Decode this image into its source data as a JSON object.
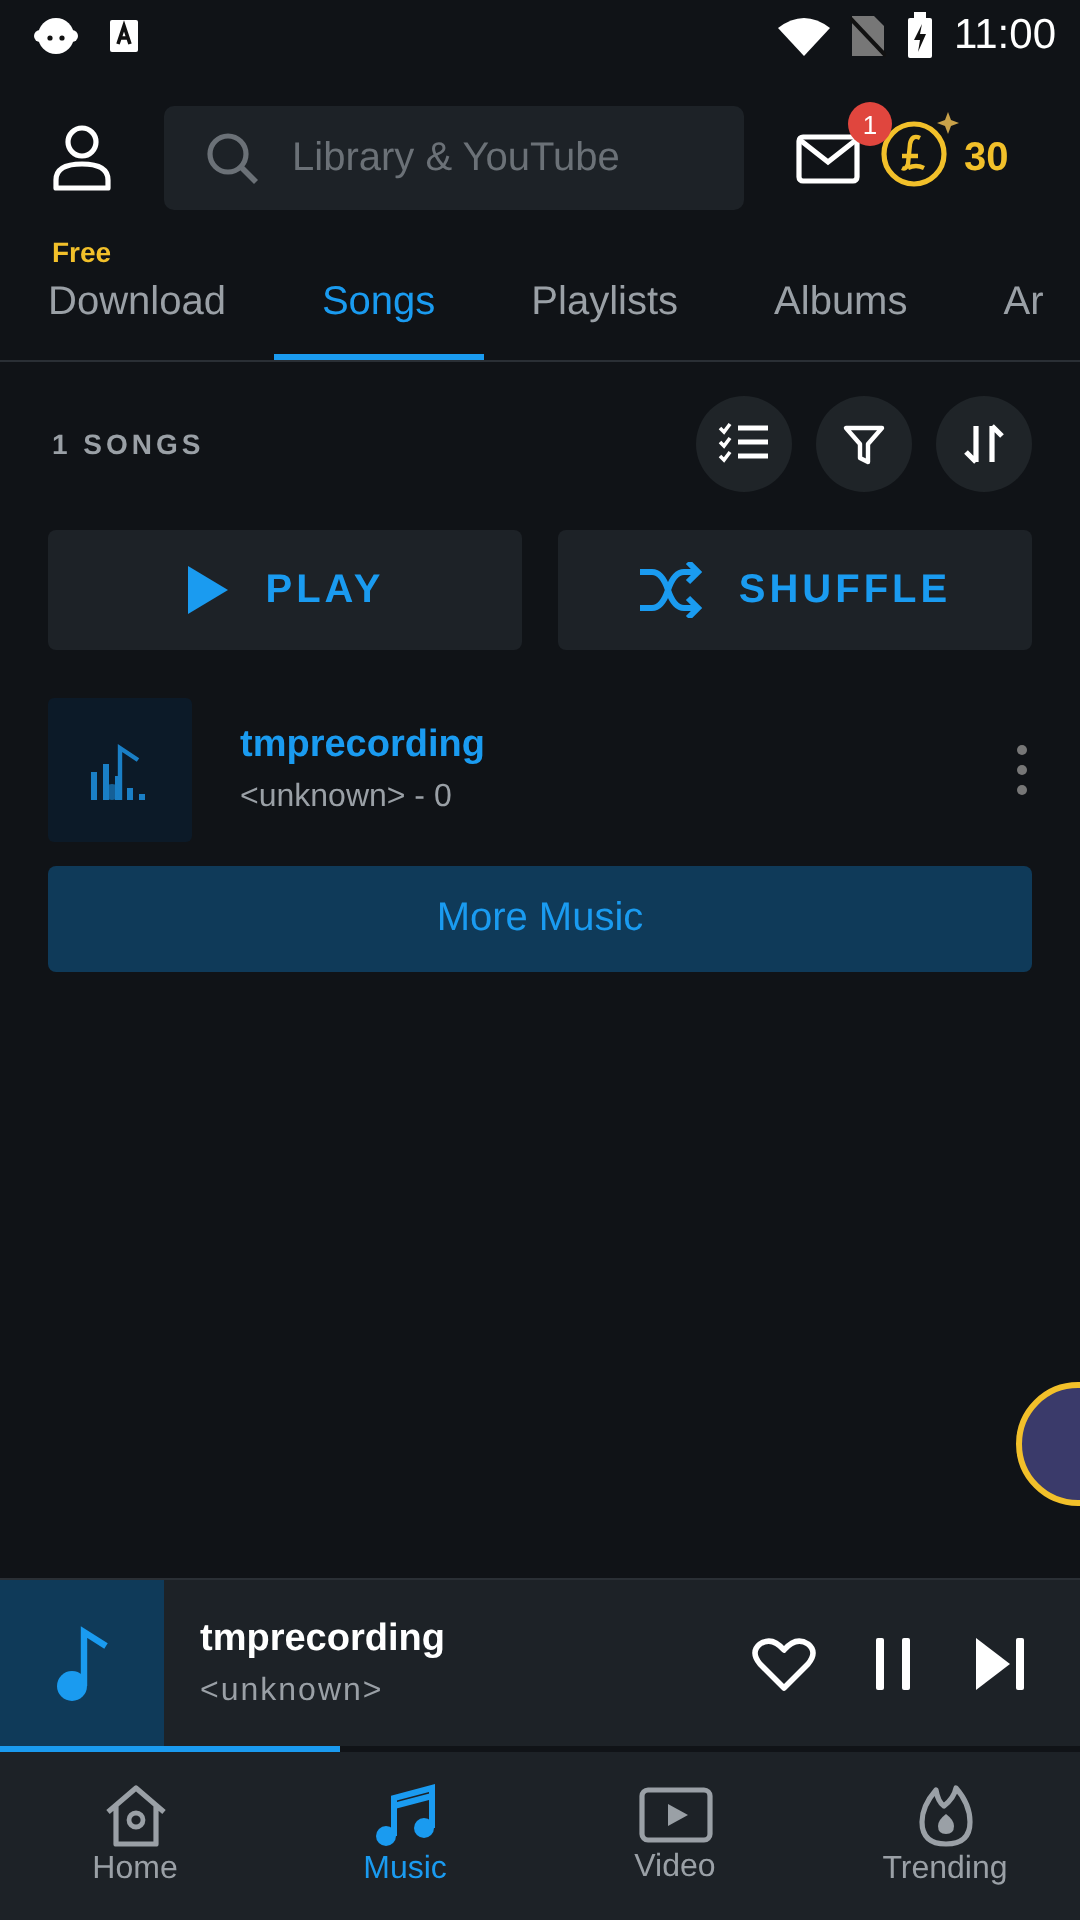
{
  "status_bar": {
    "time": "11:00"
  },
  "header": {
    "search": {
      "placeholder": "Library & YouTube"
    },
    "mail_badge": "1",
    "coins": "30"
  },
  "tabs": [
    {
      "label": "Download",
      "badge": "Free",
      "selected": false
    },
    {
      "label": "Songs",
      "selected": true
    },
    {
      "label": "Playlists",
      "selected": false
    },
    {
      "label": "Albums",
      "selected": false
    },
    {
      "label": "Ar",
      "selected": false
    }
  ],
  "songs_header": {
    "count": "1 SONGS"
  },
  "actions": [
    {
      "kind": "play",
      "label": "PLAY"
    },
    {
      "kind": "shuffle",
      "label": "SHUFFLE"
    }
  ],
  "songs": [
    {
      "title": "tmprecording",
      "subtitle": "<unknown> - 0"
    }
  ],
  "more_button": "More Music",
  "now_playing": {
    "title": "tmprecording",
    "artist": "<unknown>",
    "level": 0.315
  },
  "bottom_nav": [
    {
      "kind": "home",
      "label": "Home",
      "selected": false
    },
    {
      "kind": "music",
      "label": "Music",
      "selected": true
    },
    {
      "kind": "video",
      "label": "Video",
      "selected": false
    },
    {
      "kind": "trending",
      "label": "Trending",
      "selected": false
    }
  ]
}
